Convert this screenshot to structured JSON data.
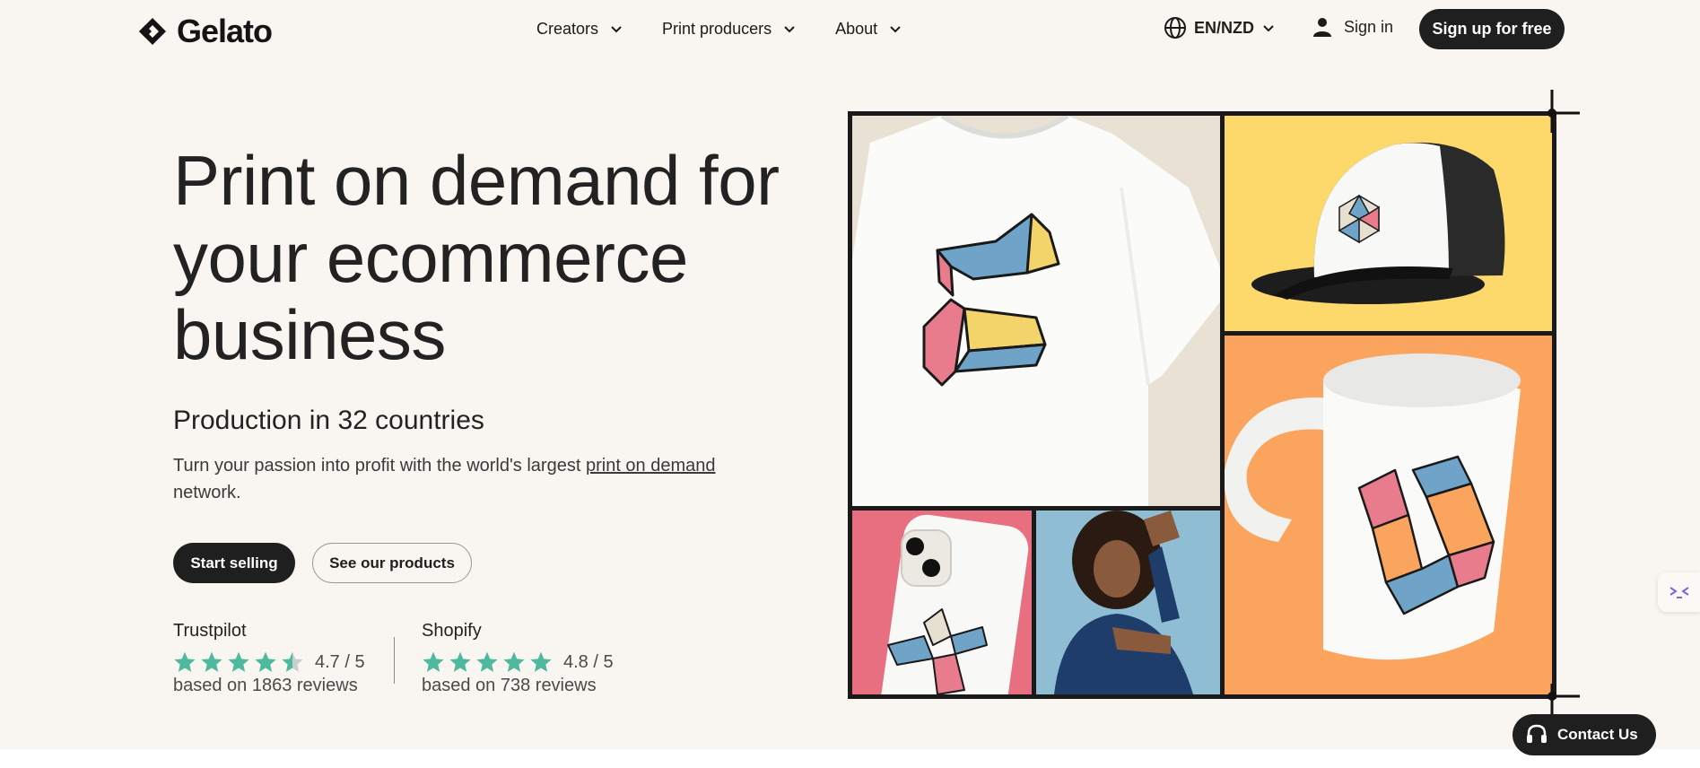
{
  "brand": {
    "name": "Gelato"
  },
  "nav": {
    "items": [
      {
        "label": "Creators"
      },
      {
        "label": "Print producers"
      },
      {
        "label": "About"
      }
    ],
    "language": "EN/NZD",
    "signin": "Sign in",
    "signup": "Sign up for free"
  },
  "hero": {
    "title": "Print on demand for your ecommerce business",
    "subheading": "Production in 32 countries",
    "description_before": "Turn your passion into profit with the world's largest",
    "description_link": "print on demand",
    "description_after": "network.",
    "primary_cta": "Start selling",
    "secondary_cta": "See our products"
  },
  "ratings": [
    {
      "source": "Trustpilot",
      "score": "4.7 / 5",
      "stars": 4.5,
      "reviews": "based on 1863 reviews"
    },
    {
      "source": "Shopify",
      "score": "4.8 / 5",
      "stars": 5,
      "reviews": "based on 738 reviews"
    }
  ],
  "contact": {
    "label": "Contact Us"
  },
  "colors": {
    "background": "#f9f5f0",
    "primary_button": "#1f1f1f",
    "star": "#4fb99f",
    "panel_yellow": "#fdd96c",
    "panel_orange": "#fba45d",
    "panel_pink": "#e86f80",
    "panel_blue": "#8fbdd3",
    "panel_cream": "#e9e2d4"
  },
  "icons": [
    "gelato-logo-icon",
    "chevron-down-icon",
    "globe-icon",
    "user-icon",
    "star-icon",
    "headset-icon",
    "chat-bot-icon"
  ]
}
